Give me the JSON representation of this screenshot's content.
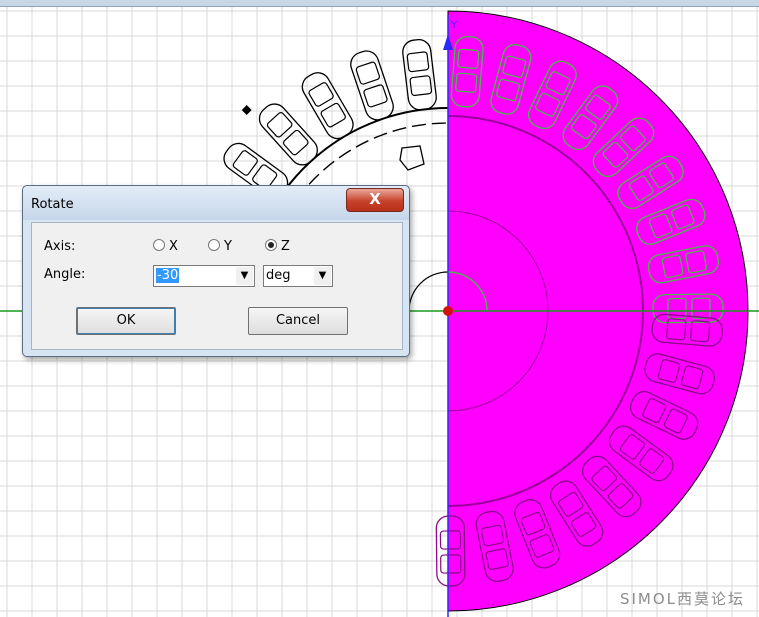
{
  "dialog": {
    "title": "Rotate",
    "close_label": "X",
    "axis_label": "Axis:",
    "axis_options": [
      "X",
      "Y",
      "Z"
    ],
    "axis_selected": "Z",
    "angle_label": "Angle:",
    "angle_value": "-30",
    "unit_value": "deg",
    "ok_label": "OK",
    "cancel_label": "Cancel"
  },
  "viewport": {
    "axis_label_y": "Y",
    "model_color": "#ff00ff",
    "outline_color": "#000000",
    "highlight_color": "#44bb44",
    "grid_color": "#d9d9d9"
  },
  "watermark": "SIMOL西莫论坛"
}
